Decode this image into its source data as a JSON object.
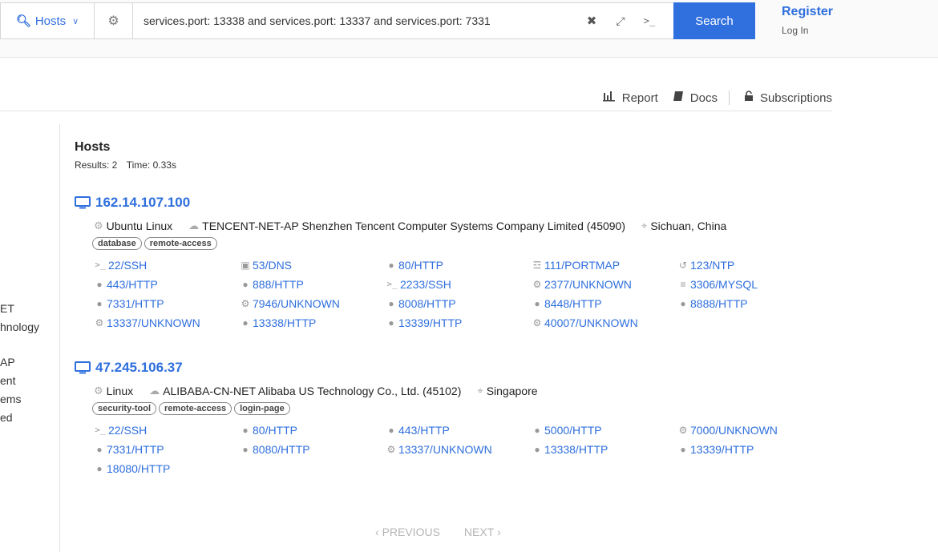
{
  "search": {
    "scope_label": "Hosts",
    "query": "services.port: 13338 and services.port: 13337 and services.port: 7331",
    "button_label": "Search"
  },
  "account": {
    "register": "Register",
    "login": "Log In"
  },
  "subnav": {
    "report": "Report",
    "docs": "Docs",
    "subscriptions": "Subscriptions"
  },
  "sidebar_fragments": [
    "ET",
    "hnology",
    "AP",
    "ent",
    "ems",
    "ed"
  ],
  "results": {
    "title": "Hosts",
    "count_text": "Results: 2",
    "time_text": "Time: 0.33s"
  },
  "hosts": [
    {
      "ip": "162.14.107.100",
      "os": "Ubuntu Linux",
      "network": "TENCENT-NET-AP Shenzhen Tencent Computer Systems Company Limited (45090)",
      "location": "Sichuan, China",
      "tags": [
        "database",
        "remote-access"
      ],
      "ports": [
        {
          "label": "22/SSH",
          "icon": "terminal-icon"
        },
        {
          "label": "53/DNS",
          "icon": "dns-icon"
        },
        {
          "label": "80/HTTP",
          "icon": "globe-icon"
        },
        {
          "label": "111/PORTMAP",
          "icon": "portmap-icon"
        },
        {
          "label": "123/NTP",
          "icon": "clock-icon"
        },
        {
          "label": "443/HTTP",
          "icon": "globe-icon"
        },
        {
          "label": "888/HTTP",
          "icon": "globe-icon"
        },
        {
          "label": "2233/SSH",
          "icon": "terminal-icon"
        },
        {
          "label": "2377/UNKNOWN",
          "icon": "gear-icon"
        },
        {
          "label": "3306/MYSQL",
          "icon": "database-icon"
        },
        {
          "label": "7331/HTTP",
          "icon": "globe-icon"
        },
        {
          "label": "7946/UNKNOWN",
          "icon": "gear-icon"
        },
        {
          "label": "8008/HTTP",
          "icon": "globe-icon"
        },
        {
          "label": "8448/HTTP",
          "icon": "globe-icon"
        },
        {
          "label": "8888/HTTP",
          "icon": "globe-icon"
        },
        {
          "label": "13337/UNKNOWN",
          "icon": "gear-icon"
        },
        {
          "label": "13338/HTTP",
          "icon": "globe-icon"
        },
        {
          "label": "13339/HTTP",
          "icon": "globe-icon"
        },
        {
          "label": "40007/UNKNOWN",
          "icon": "gear-icon"
        }
      ]
    },
    {
      "ip": "47.245.106.37",
      "os": "Linux",
      "network": "ALIBABA-CN-NET Alibaba US Technology Co., Ltd. (45102)",
      "location": "Singapore",
      "tags": [
        "security-tool",
        "remote-access",
        "login-page"
      ],
      "ports": [
        {
          "label": "22/SSH",
          "icon": "terminal-icon"
        },
        {
          "label": "80/HTTP",
          "icon": "globe-icon"
        },
        {
          "label": "443/HTTP",
          "icon": "globe-icon"
        },
        {
          "label": "5000/HTTP",
          "icon": "globe-icon"
        },
        {
          "label": "7000/UNKNOWN",
          "icon": "gear-icon"
        },
        {
          "label": "7331/HTTP",
          "icon": "globe-icon"
        },
        {
          "label": "8080/HTTP",
          "icon": "globe-icon"
        },
        {
          "label": "13337/UNKNOWN",
          "icon": "gear-icon"
        },
        {
          "label": "13338/HTTP",
          "icon": "globe-icon"
        },
        {
          "label": "13339/HTTP",
          "icon": "globe-icon"
        },
        {
          "label": "18080/HTTP",
          "icon": "globe-icon"
        }
      ]
    }
  ],
  "pager": {
    "prev": "PREVIOUS",
    "next": "NEXT"
  },
  "colors": {
    "accent": "#2f6fde",
    "muted": "#999999"
  }
}
